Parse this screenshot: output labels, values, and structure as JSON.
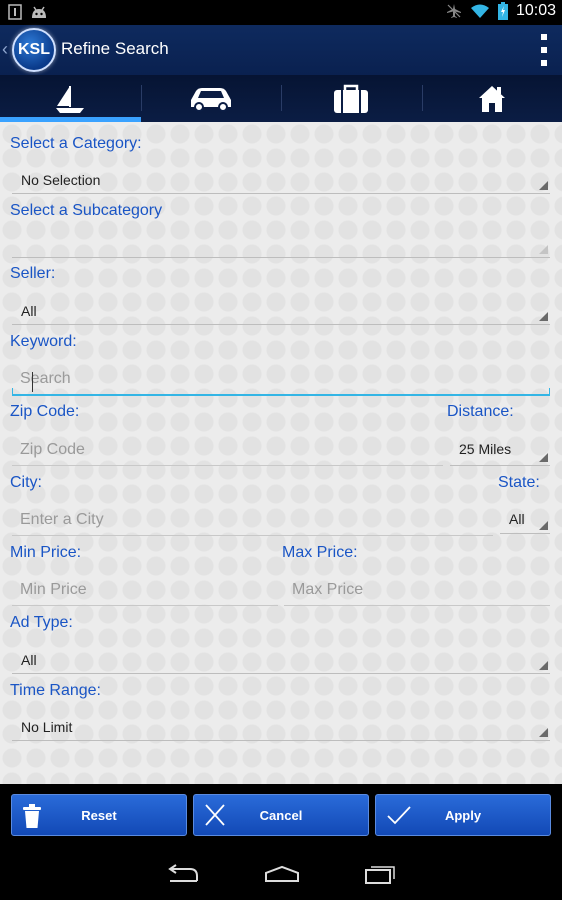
{
  "status_bar": {
    "time": "10:03"
  },
  "action_bar": {
    "logo_text": "KSL",
    "title": "Refine Search"
  },
  "tabs": [
    {
      "name": "boat",
      "active": true
    },
    {
      "name": "car",
      "active": false
    },
    {
      "name": "jobs",
      "active": false
    },
    {
      "name": "home",
      "active": false
    }
  ],
  "form": {
    "category_label": "Select a Category:",
    "category_value": "No Selection",
    "subcategory_label": "Select a Subcategory",
    "subcategory_value": "",
    "seller_label": "Seller:",
    "seller_value": "All",
    "keyword_label": "Keyword:",
    "keyword_placeholder": "Search",
    "zip_label": "Zip Code:",
    "zip_placeholder": "Zip Code",
    "distance_label": "Distance:",
    "distance_value": "25 Miles",
    "city_label": "City:",
    "city_placeholder": "Enter a City",
    "state_label": "State:",
    "state_value": "All",
    "min_price_label": "Min Price:",
    "min_price_placeholder": "Min Price",
    "max_price_label": "Max Price:",
    "max_price_placeholder": "Max Price",
    "ad_type_label": "Ad Type:",
    "ad_type_value": "All",
    "time_range_label": "Time Range:",
    "time_range_value": "No Limit"
  },
  "buttons": {
    "reset": "Reset",
    "cancel": "Cancel",
    "apply": "Apply"
  },
  "colors": {
    "label_blue": "#1a55c5",
    "accent": "#3aa2ff",
    "button_blue": "#1f5bc9"
  }
}
